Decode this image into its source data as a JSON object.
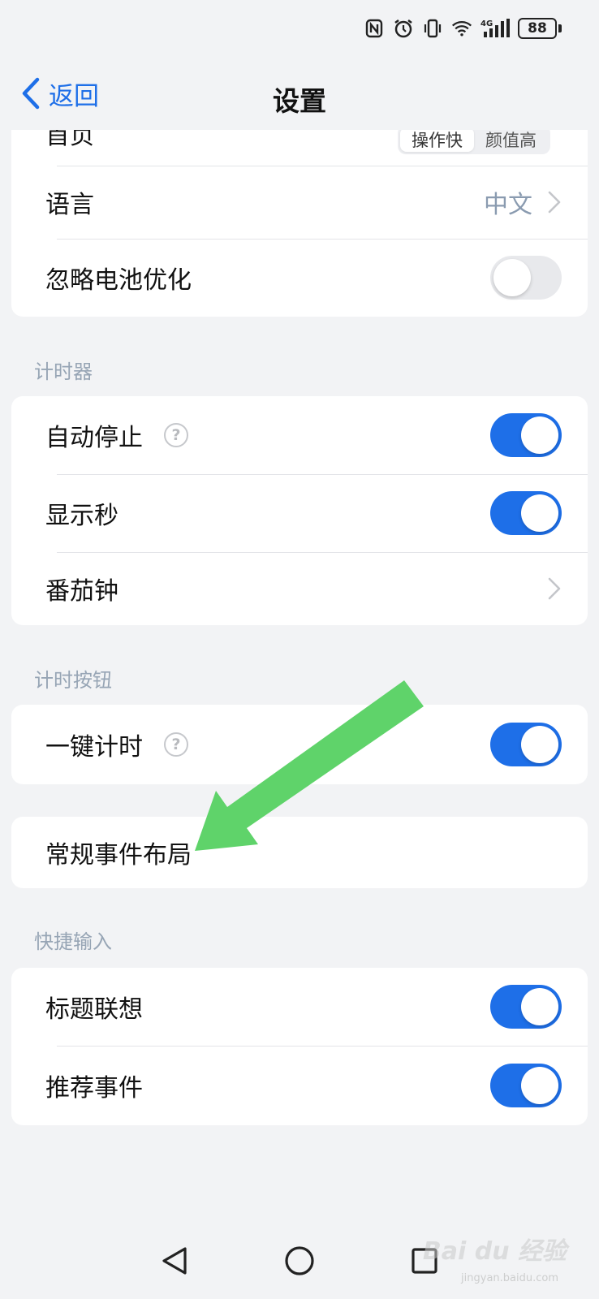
{
  "status_bar": {
    "battery": "88",
    "network": "4G"
  },
  "header": {
    "back_label": "返回",
    "title": "设置"
  },
  "general": {
    "homepage_label": "首页",
    "homepage_options": [
      "操作快",
      "颜值高"
    ],
    "language_label": "语言",
    "language_value": "中文",
    "battery_opt_label": "忽略电池优化",
    "battery_opt_on": false
  },
  "timer_section": {
    "title": "计时器",
    "auto_stop_label": "自动停止",
    "auto_stop_on": true,
    "show_seconds_label": "显示秒",
    "show_seconds_on": true,
    "pomodoro_label": "番茄钟"
  },
  "timer_button_section": {
    "title": "计时按钮",
    "one_key_label": "一键计时",
    "one_key_on": true
  },
  "layout_row": {
    "label": "常规事件布局"
  },
  "quick_input_section": {
    "title": "快捷输入",
    "title_suggest_label": "标题联想",
    "title_suggest_on": true,
    "recommend_label": "推荐事件",
    "recommend_on": true
  },
  "watermark": {
    "brand": "Bai du 经验",
    "url": "jingyan.baidu.com"
  },
  "colors": {
    "accent": "#1e6fe8",
    "arrow": "#5fd36a",
    "background": "#f2f3f5"
  }
}
